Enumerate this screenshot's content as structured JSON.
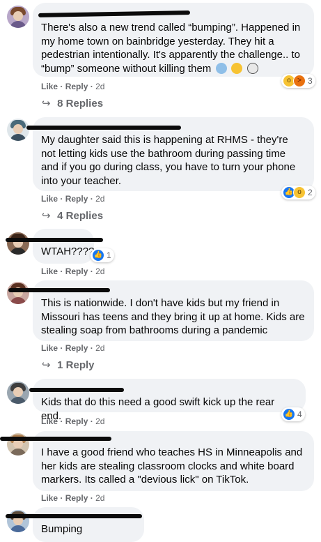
{
  "colors": {
    "bubble": "#f0f2f5",
    "meta": "#65676b",
    "like": "#1877f2",
    "wow": "#f7c333",
    "angry": "#e9710f",
    "redaction": "#0b0b0b"
  },
  "actions": {
    "like": "Like",
    "sep": "·",
    "reply": "Reply"
  },
  "comments": [
    {
      "text": "There's also a new trend called “bumping”. Happened in\nmy home town on bainbridge yesterday. They hit a\npedestrian intentionally. It's apparently the challenge.. to\n“bump” someone without killing them",
      "time": "2d",
      "reactions": [
        "wow-icon",
        "angry-icon"
      ],
      "reaction_count": "3",
      "replies": "8 Replies"
    },
    {
      "text": "My daughter said this is happening at RHMS - they're\nnot letting kids use the bathroom during passing time\nand if you go during class, you have to turn your phone\ninto your teacher.",
      "time": "2d",
      "reactions": [
        "like-icon",
        "wow-icon"
      ],
      "reaction_count": "2",
      "replies": "4 Replies"
    },
    {
      "text": "WTAH????",
      "time": "2d",
      "reactions": [
        "like-icon"
      ],
      "reaction_count": "1"
    },
    {
      "text": "This is nationwide. I don't have kids but my friend in\nMissouri has teens and they bring it up at home. Kids are\nstealing soap from bathrooms during a pandemic",
      "time": "2d",
      "replies": "1 Reply"
    },
    {
      "text": "Kids that do this need a good swift kick up the rear end.",
      "time": "2d",
      "reactions": [
        "like-icon"
      ],
      "reaction_count": "4"
    },
    {
      "text": "I have a good friend who teaches HS in Minneapolis and\nher kids are stealing classroom clocks and white board\nmarkers. Its called a \"devious lick\" on TikTok.",
      "time": "2d"
    },
    {
      "text": "Bumping"
    }
  ]
}
